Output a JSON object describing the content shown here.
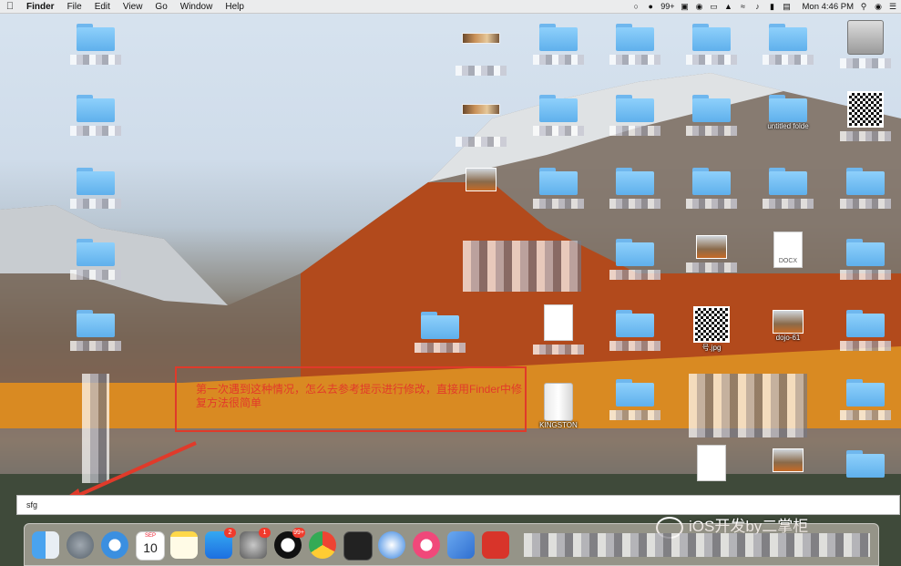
{
  "menubar": {
    "app": "Finder",
    "menus": [
      "File",
      "Edit",
      "View",
      "Go",
      "Window",
      "Help"
    ],
    "qq_badge": "99+",
    "clock": "Mon 4:46 PM"
  },
  "desktop": {
    "labels": {
      "kingston": "KINGSTON",
      "docx": "DOCX",
      "untitled_folder": "untitled folde",
      "jpg_fragment": "号.jpg",
      "dojo_fragment": "dojo-61"
    }
  },
  "annotation": {
    "text": "第一次遇到这种情况，怎么去参考提示进行修改，直接用Finder中修复方法很简单"
  },
  "rename_field": {
    "value": "sfg"
  },
  "dock": {
    "calendar_month": "SEP",
    "calendar_day": "10",
    "appstore_badge": "2",
    "prefs_badge": "1",
    "qq_badge": "99+"
  },
  "watermark": {
    "text": "iOS开发by二掌柜"
  },
  "colors": {
    "annotation_red": "#e03a2a",
    "folder_blue": "#6fb7ee",
    "badge_red": "#f03a2c"
  }
}
